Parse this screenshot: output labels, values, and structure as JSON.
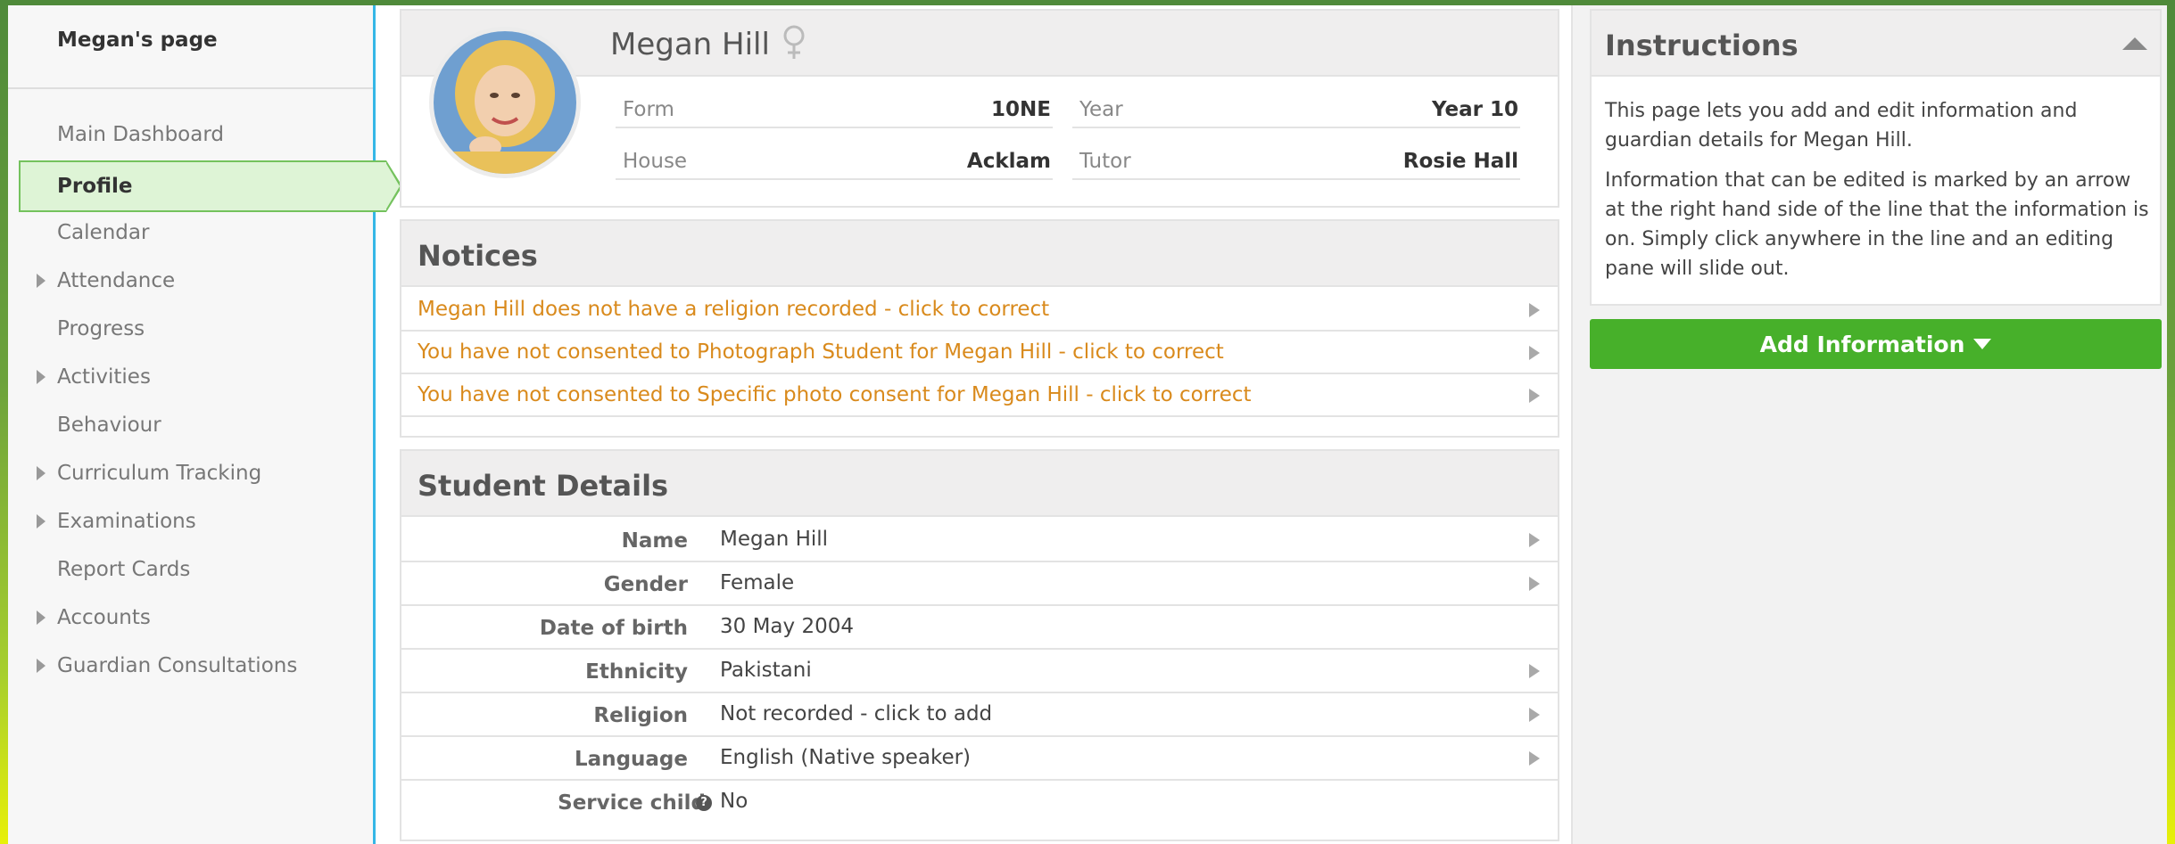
{
  "sidebar": {
    "title": "Megan's page",
    "items": [
      {
        "label": "Main Dashboard",
        "expandable": false
      },
      {
        "label": "Profile",
        "expandable": false,
        "active": true
      },
      {
        "label": "Calendar",
        "expandable": false
      },
      {
        "label": "Attendance",
        "expandable": true
      },
      {
        "label": "Progress",
        "expandable": false
      },
      {
        "label": "Activities",
        "expandable": true
      },
      {
        "label": "Behaviour",
        "expandable": false
      },
      {
        "label": "Curriculum Tracking",
        "expandable": true
      },
      {
        "label": "Examinations",
        "expandable": true
      },
      {
        "label": "Report Cards",
        "expandable": false
      },
      {
        "label": "Accounts",
        "expandable": true
      },
      {
        "label": "Guardian Consultations",
        "expandable": true
      }
    ]
  },
  "profile": {
    "name": "Megan Hill",
    "gender_icon": "female-symbol-icon",
    "form_label": "Form",
    "form_value": "10NE",
    "year_label": "Year",
    "year_value": "Year 10",
    "house_label": "House",
    "house_value": "Acklam",
    "tutor_label": "Tutor",
    "tutor_value": "Rosie Hall"
  },
  "notices": {
    "title": "Notices",
    "items": [
      "Megan Hill does not have a religion recorded - click to correct",
      "You have not consented to Photograph Student for Megan Hill - click to correct",
      "You have not consented to Specific photo consent for Megan Hill - click to correct"
    ]
  },
  "details": {
    "title": "Student Details",
    "rows": [
      {
        "label": "Name",
        "value": "Megan Hill",
        "editable": true
      },
      {
        "label": "Gender",
        "value": "Female",
        "editable": true
      },
      {
        "label": "Date of birth",
        "value": "30 May 2004",
        "editable": false
      },
      {
        "label": "Ethnicity",
        "value": "Pakistani",
        "editable": true
      },
      {
        "label": "Religion",
        "value": "Not recorded - click to add",
        "editable": true
      },
      {
        "label": "Language",
        "value": "English (Native speaker)",
        "editable": true
      },
      {
        "label": "Service child",
        "value": "No",
        "editable": false,
        "help": "?"
      }
    ]
  },
  "instructions": {
    "title": "Instructions",
    "p1": "This page lets you add and edit information and guardian details for Megan Hill.",
    "p2": "Information that can be edited is marked by an arrow at the right hand side of the line that the information is on. Simply click anywhere in the line and an editing pane will slide out."
  },
  "add_info_button": "Add Information",
  "colors": {
    "accent_blue": "#35b7e6",
    "active_green": "#74c25d",
    "button_green": "#47b02a",
    "notice_orange": "#d98a1c"
  }
}
